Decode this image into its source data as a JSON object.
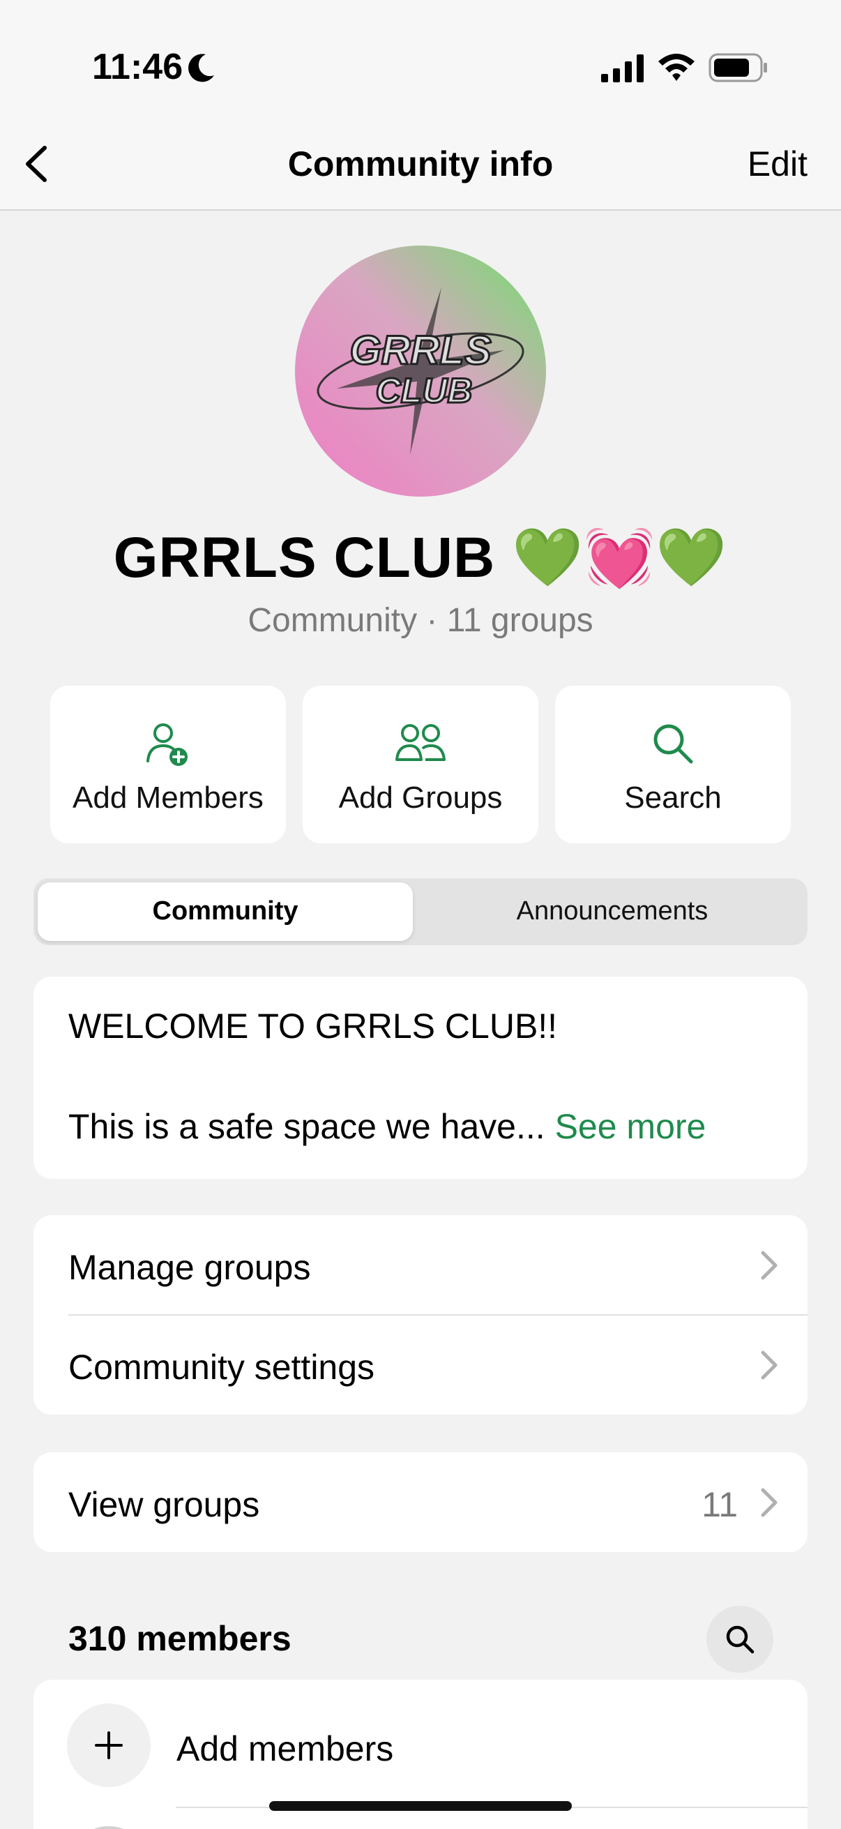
{
  "status_bar": {
    "time": "11:46",
    "icons": [
      "moon-icon",
      "signal-icon",
      "wifi-icon",
      "battery-icon"
    ]
  },
  "nav": {
    "back_icon": "chevron-left-icon",
    "title": "Community info",
    "edit_label": "Edit"
  },
  "avatar": {
    "logo_text_line1": "GRRLS",
    "logo_text_line2": "CLUB"
  },
  "community": {
    "name": "GRRLS CLUB 💚💓💚",
    "subtitle": "Community · 11 groups"
  },
  "actions": [
    {
      "label": "Add Members",
      "icon": "add-person-icon"
    },
    {
      "label": "Add Groups",
      "icon": "group-icon"
    },
    {
      "label": "Search",
      "icon": "search-icon"
    }
  ],
  "tabs": [
    {
      "label": "Community",
      "active": true
    },
    {
      "label": "Announcements",
      "active": false
    }
  ],
  "description": {
    "line1": "WELCOME TO GRRLS CLUB!!",
    "line2": "This is a safe space we have...",
    "see_more": "See more"
  },
  "settings_list": [
    {
      "label": "Manage groups"
    },
    {
      "label": "Community settings"
    }
  ],
  "view_groups": {
    "label": "View groups",
    "count": "11"
  },
  "members": {
    "title": "310 members",
    "add_label": "Add members"
  },
  "colors": {
    "accent_green": "#1f8a4c",
    "background": "#f2f2f2"
  }
}
